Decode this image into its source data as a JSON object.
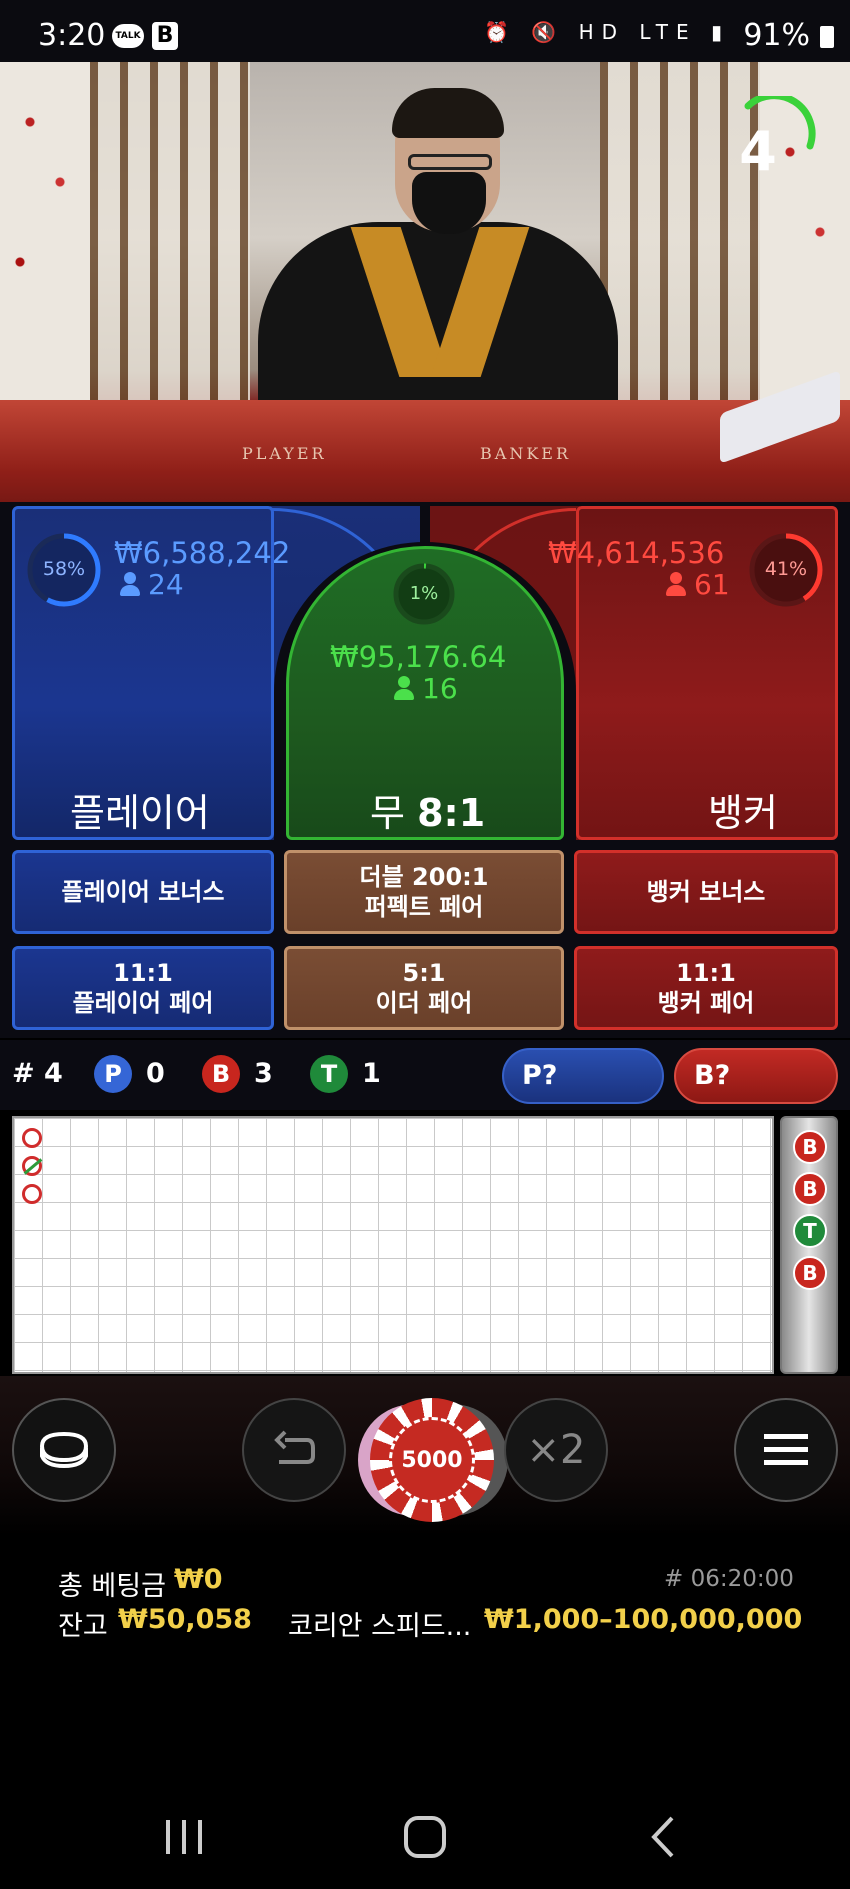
{
  "status_bar": {
    "time": "3:20",
    "talk_label": "TALK",
    "app_letter": "B",
    "sys_icons": "⏰ 🔇 HD LTE ▮",
    "battery": "91%"
  },
  "video": {
    "countdown": "4",
    "table_labels": {
      "player": "PLAYER",
      "banker": "BANKER"
    }
  },
  "board": {
    "player": {
      "percent": "58%",
      "amount": "₩6,588,242",
      "count": "24",
      "label": "플레이어",
      "fill": 0.58,
      "color": "#2f7bff"
    },
    "tie": {
      "percent": "1%",
      "amount": "₩95,176.64",
      "count": "16",
      "label": "무",
      "odds": "8:1",
      "fill": 0.01,
      "color": "#3ad23a"
    },
    "banker": {
      "percent": "41%",
      "amount": "₩4,614,536",
      "count": "61",
      "label": "뱅커",
      "fill": 0.41,
      "color": "#ff3a30"
    }
  },
  "side_bets": {
    "player_bonus": "플레이어 보너스",
    "perfect_pair_line1": "더블 200:1",
    "perfect_pair_line2": "퍼펙트 페어",
    "banker_bonus": "뱅커 보너스",
    "player_pair_line1": "11:1",
    "player_pair_line2": "플레이어 페어",
    "either_pair_line1": "5:1",
    "either_pair_line2": "이더 페어",
    "banker_pair_line1": "11:1",
    "banker_pair_line2": "뱅커 페어"
  },
  "stats": {
    "round": "# 4",
    "p_letter": "P",
    "p_count": "0",
    "b_letter": "B",
    "b_count": "3",
    "t_letter": "T",
    "t_count": "1",
    "player_predict": "P?",
    "banker_predict": "B?"
  },
  "road_side": [
    "B",
    "B",
    "T",
    "B"
  ],
  "controls": {
    "chip_value": "5000",
    "double_label": "×2"
  },
  "info": {
    "total_bet_label": "총 베팅금",
    "total_bet_value": "₩0",
    "game_id": "# 06:20:00",
    "balance_label": "잔고",
    "balance_value": "₩50,058",
    "table_name": "코리안 스피드...",
    "limits": "₩1,000–100,000,000"
  },
  "colors": {
    "player": "#2f63d6",
    "banker": "#d2302a",
    "tie": "#33b533",
    "accent_yellow": "#f2d04a"
  }
}
